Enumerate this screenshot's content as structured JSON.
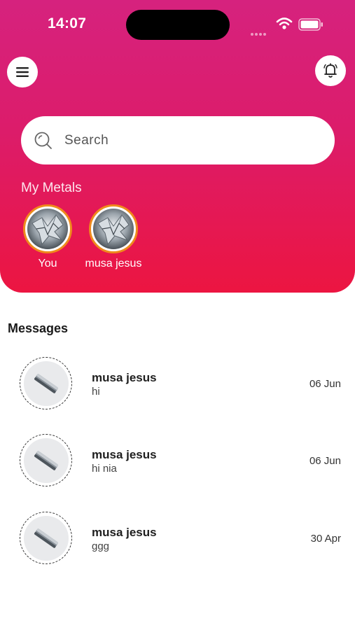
{
  "status_bar": {
    "time": "14:07"
  },
  "search": {
    "placeholder": "Search"
  },
  "metals": {
    "title": "My Metals",
    "items": [
      {
        "label": "You"
      },
      {
        "label": "musa jesus"
      }
    ]
  },
  "messages": {
    "title": "Messages",
    "items": [
      {
        "name": "musa jesus",
        "preview": "hi",
        "date": "06 Jun"
      },
      {
        "name": "musa jesus",
        "preview": "hi nia",
        "date": "06 Jun"
      },
      {
        "name": "musa jesus",
        "preview": "ggg",
        "date": "30 Apr"
      }
    ]
  },
  "colors": {
    "header_gradient_top": "#d6227e",
    "header_gradient_bottom": "#ec1541",
    "metal_ring": "#ef8a1c"
  },
  "icons": [
    "menu-icon",
    "bell-icon",
    "search-icon",
    "wifi-icon",
    "battery-icon",
    "metal-avatar-icon"
  ]
}
